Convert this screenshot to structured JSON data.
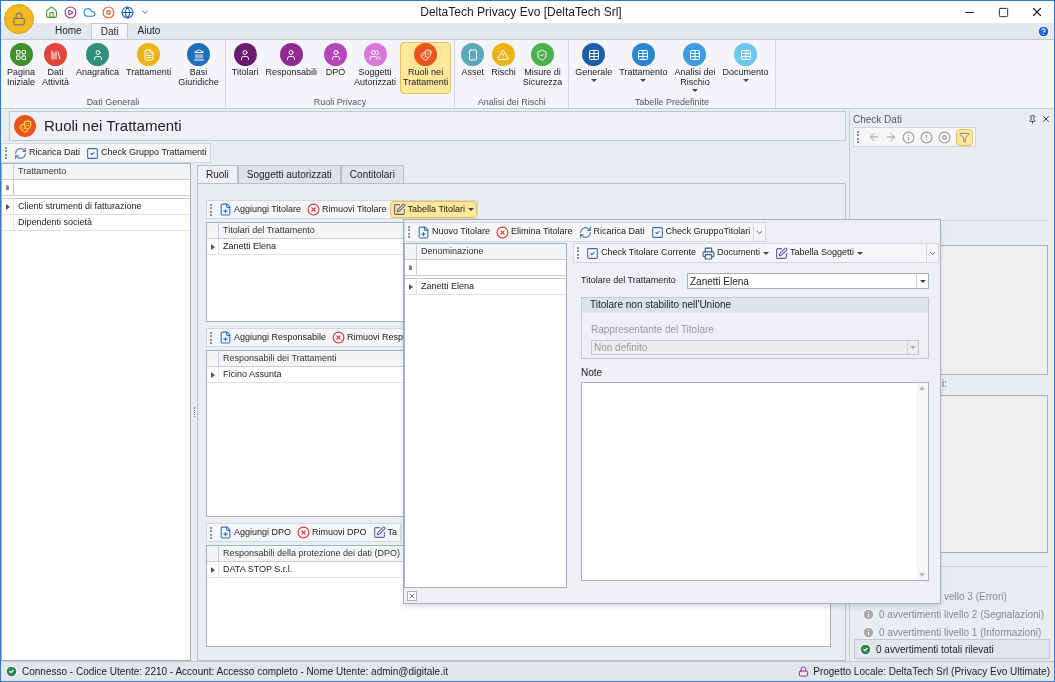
{
  "window": {
    "title": "DeltaTech Privacy Evo [DeltaTech Srl]"
  },
  "ribbon": {
    "tabs": [
      {
        "label": "Home",
        "selected": false
      },
      {
        "label": "Dati",
        "selected": true
      },
      {
        "label": "Aiuto",
        "selected": false
      }
    ],
    "groups": [
      {
        "label": "Dati Generali",
        "items": [
          {
            "label": "Pagina\nIniziale",
            "selected": false,
            "dropdown": false
          },
          {
            "label": "Dati\nAttività",
            "selected": false,
            "dropdown": false
          },
          {
            "label": "Anagrafica",
            "selected": false,
            "dropdown": false
          },
          {
            "label": "Trattamenti",
            "selected": false,
            "dropdown": false
          },
          {
            "label": "Basi\nGiuridiche",
            "selected": false,
            "dropdown": false
          }
        ]
      },
      {
        "label": "Ruoli Privacy",
        "items": [
          {
            "label": "Titolari",
            "selected": false,
            "dropdown": false
          },
          {
            "label": "Responsabili",
            "selected": false,
            "dropdown": false
          },
          {
            "label": "DPO",
            "selected": false,
            "dropdown": false
          },
          {
            "label": "Soggetti\nAutorizzati",
            "selected": false,
            "dropdown": false
          },
          {
            "label": "Ruoli nei\nTrattamenti",
            "selected": true,
            "dropdown": false
          }
        ]
      },
      {
        "label": "Analisi dei Rischi",
        "items": [
          {
            "label": "Asset",
            "selected": false,
            "dropdown": false
          },
          {
            "label": "Rischi",
            "selected": false,
            "dropdown": false
          },
          {
            "label": "Misure di\nSicurezza",
            "selected": false,
            "dropdown": false
          }
        ]
      },
      {
        "label": "Tabelle Predefinite",
        "items": [
          {
            "label": "Generale",
            "selected": false,
            "dropdown": true
          },
          {
            "label": "Trattamento",
            "selected": false,
            "dropdown": true
          },
          {
            "label": "Analisi dei\nRischio",
            "selected": false,
            "dropdown": true
          },
          {
            "label": "Documento",
            "selected": false,
            "dropdown": true
          }
        ]
      }
    ]
  },
  "page": {
    "title": "Ruoli nei Trattamenti",
    "toolbar": [
      {
        "label": "Ricarica Dati",
        "kind": "reload"
      },
      {
        "label": "Check Gruppo Trattamenti",
        "kind": "check"
      }
    ],
    "grid": {
      "column": "Trattamento",
      "rows": [
        {
          "label": "Clienti strumenti di fatturazione",
          "selected": true
        },
        {
          "label": "Dipendenti società",
          "selected": false
        }
      ]
    },
    "tabs": [
      {
        "label": "Ruoli",
        "selected": true
      },
      {
        "label": "Soggetti autorizzati",
        "selected": false
      },
      {
        "label": "Contitolari",
        "selected": false
      }
    ],
    "sections": [
      {
        "toolbar": [
          {
            "label": "Aggiungi Titolare",
            "kind": "add",
            "active": false
          },
          {
            "label": "Rimuovi Titolare",
            "kind": "remove",
            "active": false
          },
          {
            "label": "Tabella Titolari",
            "kind": "table",
            "active": true
          }
        ],
        "column": "Titolari del Trattamento",
        "rows": [
          "Zanetti Elena"
        ]
      },
      {
        "toolbar": [
          {
            "label": "Aggiungi Responsabile",
            "kind": "add",
            "active": false
          },
          {
            "label": "Rimuovi Resp",
            "kind": "remove",
            "active": false
          }
        ],
        "column": "Responsabili dei Trattamenti",
        "rows": [
          "Ficino Assunta"
        ]
      },
      {
        "toolbar": [
          {
            "label": "Aggiungi DPO",
            "kind": "add",
            "active": false
          },
          {
            "label": "Rimuovi DPO",
            "kind": "remove",
            "active": false
          },
          {
            "label": "Ta",
            "kind": "table",
            "active": false
          }
        ],
        "column": "Responsabili della protezione dei dati (DPO)",
        "rows": [
          "DATA STOP S.r.l."
        ]
      }
    ]
  },
  "popup": {
    "toolbar": [
      {
        "label": "Nuovo Titolare",
        "kind": "add"
      },
      {
        "label": "Elimina Titolare",
        "kind": "remove"
      },
      {
        "label": "Ricarica Dati",
        "kind": "reload"
      },
      {
        "label": "Check GruppoTitolari",
        "kind": "check"
      }
    ],
    "grid": {
      "column": "Denominazione",
      "rows": [
        "Zanetti Elena"
      ]
    },
    "detail_toolbar": [
      {
        "label": "Check Titolare Corrente",
        "kind": "check"
      },
      {
        "label": "Documenti",
        "kind": "print"
      },
      {
        "label": "Tabella Soggetti",
        "kind": "table"
      }
    ],
    "owner": {
      "label": "Titolare del Trattamento",
      "value": "Zanetti Elena"
    },
    "group": {
      "title": "Titolare non stabilito nell'Unione",
      "label": "Rappresentante del Titolare",
      "value": "Non definito",
      "disabled": true
    },
    "notes": {
      "label": "Note"
    }
  },
  "check_panel": {
    "title": "Check Dati",
    "filter_on": true,
    "list_label": "i:",
    "levels": [
      {
        "label": "vello 3 (Errori)",
        "kind": "cut"
      },
      {
        "label": "0 avvertimenti livello 2 (Segnalazioni)",
        "kind": "warning"
      },
      {
        "label": "0 avvertimenti livello 1 (Informazioni)",
        "kind": "info"
      }
    ],
    "total": "0 avvertimenti totali rilevati"
  },
  "status_bar": {
    "left": "Connesso - Codice Utente: 2210 - Account: Accesso completo - Nome Utente: admin@digitale.it",
    "right": "Progetto Locale: DeltaTech Srl (Privacy Evo Ultimate)"
  }
}
